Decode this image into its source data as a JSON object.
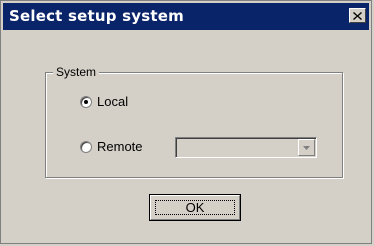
{
  "dialog": {
    "title": "Select setup system",
    "close_glyph": "×"
  },
  "system_group": {
    "label": "System",
    "options": [
      {
        "label": "Local",
        "checked": true
      },
      {
        "label": "Remote",
        "checked": false
      }
    ],
    "remote_combo": {
      "value": "",
      "enabled": false
    }
  },
  "buttons": {
    "ok_label": "OK"
  },
  "colors": {
    "titlebar": "#0a246a",
    "face": "#d4d0c8"
  },
  "icons": {
    "close": "close-icon",
    "dropdown": "chevron-down-icon"
  }
}
